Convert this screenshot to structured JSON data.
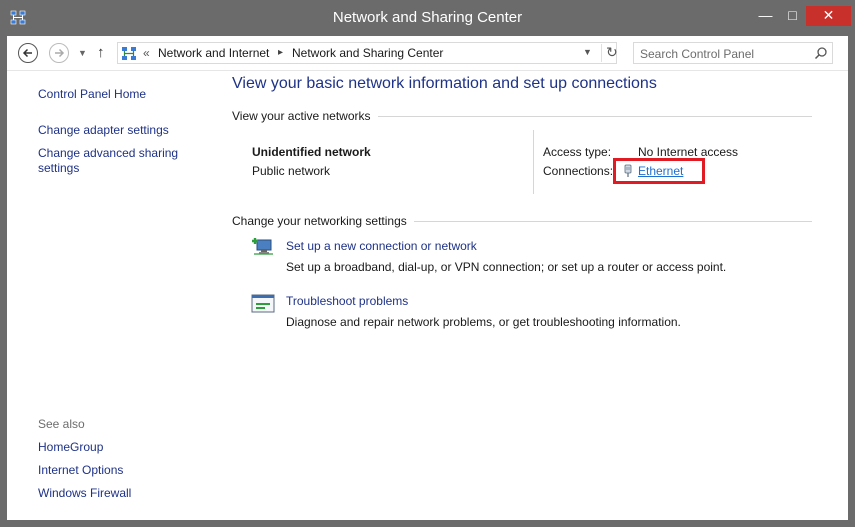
{
  "window": {
    "title": "Network and Sharing Center",
    "controls": {
      "minimize": "—",
      "maximize": "□",
      "close": "✕"
    },
    "accent_close": "#c7302b"
  },
  "toolbar": {
    "breadcrumb_lead": "«",
    "breadcrumb": [
      "Network and Internet",
      "Network and Sharing Center"
    ],
    "search_placeholder": "Search Control Panel"
  },
  "sidebar": {
    "items": [
      {
        "label": "Control Panel Home"
      },
      {
        "label": "Change adapter settings"
      },
      {
        "label": "Change advanced sharing"
      },
      {
        "label": "settings"
      }
    ],
    "see_also_label": "See also",
    "see_also": [
      {
        "label": "HomeGroup"
      },
      {
        "label": "Internet Options"
      },
      {
        "label": "Windows Firewall"
      }
    ]
  },
  "main": {
    "heading": "View your basic network information and set up connections",
    "active_networks_label": "View your active networks",
    "network": {
      "name": "Unidentified network",
      "type": "Public network",
      "access_type_label": "Access type:",
      "access_type_value": "No Internet access",
      "connections_label": "Connections:",
      "connection_link": "Ethernet"
    },
    "change_settings_label": "Change your networking settings",
    "tasks": [
      {
        "title": "Set up a new connection or network",
        "description": "Set up a broadband, dial-up, or VPN connection; or set up a router or access point.",
        "icon": "new-connection-icon"
      },
      {
        "title": "Troubleshoot problems",
        "description": "Diagnose and repair network problems, or get troubleshooting information.",
        "icon": "troubleshoot-icon"
      }
    ]
  },
  "colors": {
    "link": "#1e3287",
    "highlight_box": "#e01b24",
    "titlebar": "#6b6b6b"
  }
}
